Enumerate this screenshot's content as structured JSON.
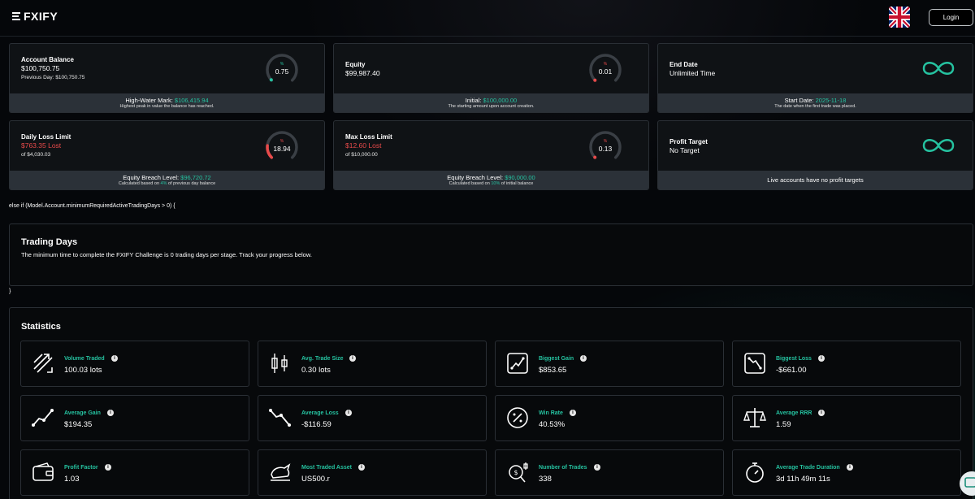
{
  "header": {
    "logo_text": "FXIFY",
    "login_label": "Login",
    "flag_icon": "uk-flag-icon"
  },
  "colors": {
    "accent": "#25c2a0",
    "danger": "#e84a4a",
    "card_bg": "#0f1215",
    "footer_bg": "#2b3138"
  },
  "account_balance": {
    "title": "Account Balance",
    "value": "$100,750.75",
    "sub": "Previous Day: $100,750.75",
    "gauge_pct": "%",
    "gauge_value": "0.75",
    "foot_label": "High-Water Mark: ",
    "foot_value": "$106,415.94",
    "foot_sub": "Highest peak in value the balance has reached."
  },
  "equity": {
    "title": "Equity",
    "value": "$99,987.40",
    "gauge_pct": "%",
    "gauge_value": "0.01",
    "foot_label": "Initial: ",
    "foot_value": "$100,000.00",
    "foot_sub": "The starting amount upon account creation."
  },
  "end_date": {
    "title": "End Date",
    "value": "Unlimited Time",
    "foot_label": "Start Date: ",
    "foot_value": "2025-11-18",
    "foot_sub": "The date when the first trade was placed."
  },
  "daily_loss": {
    "title": "Daily Loss Limit",
    "value": "$763.35 Lost",
    "sub": "of $4,030.03",
    "gauge_pct": "%",
    "gauge_value": "18.94",
    "foot_label": "Equity Breach Level: ",
    "foot_value": "$96,720.72",
    "foot_sub_a": "Calculated based on ",
    "foot_sub_pct": "4%",
    "foot_sub_b": " of previous day balance"
  },
  "max_loss": {
    "title": "Max Loss Limit",
    "value": "$12.60 Lost",
    "sub": "of $10,000.00",
    "gauge_pct": "%",
    "gauge_value": "0.13",
    "foot_label": "Equity Breach Level: ",
    "foot_value": "$90,000.00",
    "foot_sub_a": "Calculated based on ",
    "foot_sub_pct": "10%",
    "foot_sub_b": " of initial balance"
  },
  "profit_target": {
    "title": "Profit Target",
    "value": "No Target",
    "foot": "Live accounts have no profit targets"
  },
  "code_open": "else if (Model.Account.minimumRequiredActiveTradingDays > 0) {",
  "code_close": "}",
  "trading_days": {
    "title": "Trading Days",
    "description": "The minimum time to complete the FXIFY Challenge is 0 trading days per stage. Track your progress below."
  },
  "statistics": {
    "title": "Statistics",
    "items": [
      {
        "label": "Volume Traded",
        "value": "100.03 lots",
        "icon": "volume-arrows-icon"
      },
      {
        "label": "Avg. Trade Size",
        "value": "0.30 lots",
        "icon": "candlestick-icon"
      },
      {
        "label": "Biggest Gain",
        "value": "$853.65",
        "icon": "trend-up-box-icon"
      },
      {
        "label": "Biggest Loss",
        "value": "-$661.00",
        "icon": "trend-down-box-icon"
      },
      {
        "label": "Average Gain",
        "value": "$194.35",
        "icon": "line-up-icon"
      },
      {
        "label": "Average Loss",
        "value": "-$116.59",
        "icon": "line-down-icon"
      },
      {
        "label": "Win Rate",
        "value": "40.53%",
        "icon": "percent-circle-icon"
      },
      {
        "label": "Average RRR",
        "value": "1.59",
        "icon": "scales-icon"
      },
      {
        "label": "Profit Factor",
        "value": "1.03",
        "icon": "wallet-icon"
      },
      {
        "label": "Most Traded Asset",
        "value": "US500.r",
        "icon": "bull-icon"
      },
      {
        "label": "Number of Trades",
        "value": "338",
        "icon": "trades-chart-icon"
      },
      {
        "label": "Average Trade Duration",
        "value": "3d 11h 49m 11s",
        "icon": "stopwatch-icon"
      }
    ]
  },
  "gauges": {
    "balance_level": 0.0075,
    "equity_level": 0.0001,
    "daily_loss_level": 0.1894,
    "max_loss_level": 0.0013
  }
}
